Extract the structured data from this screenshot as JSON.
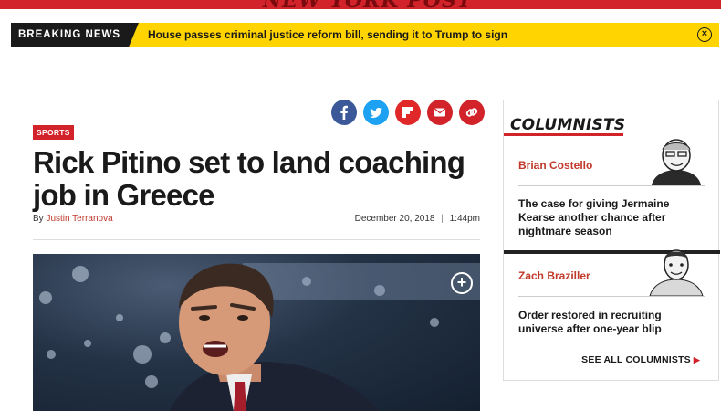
{
  "breaking": {
    "label": "BREAKING NEWS",
    "headline": "House passes criminal justice reform bill, sending it to Trump to sign",
    "close_glyph": "×"
  },
  "article": {
    "section": "SPORTS",
    "title": "Rick Pitino set to land coaching job in Greece",
    "by_prefix": "By ",
    "author": "Justin Terranova",
    "date": "December 20, 2018",
    "date_separator": "|",
    "time": "1:44pm",
    "expand_glyph": "+"
  },
  "share": {
    "icons": [
      "facebook-icon",
      "twitter-icon",
      "flipboard-icon",
      "email-icon",
      "link-icon"
    ],
    "colors": [
      "#3b5998",
      "#1da1f2",
      "#e12828",
      "#d2232a",
      "#d2232a"
    ]
  },
  "columnists": {
    "heading": "COLUMNISTS",
    "items": [
      {
        "name": "Brian Costello",
        "article": "The case for giving Jermaine Kearse another chance after nightmare season"
      },
      {
        "name": "Zach Braziller",
        "article": "Order restored in recruiting universe after one-year blip"
      }
    ],
    "see_all": "SEE ALL COLUMNISTS",
    "see_all_glyph": "▶"
  },
  "colors": {
    "brand_red": "#d2232a",
    "breaking_yellow": "#ffd400",
    "dark": "#1a1a1a"
  }
}
